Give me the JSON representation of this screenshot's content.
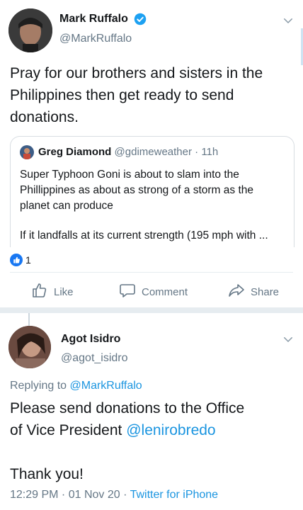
{
  "tweet": {
    "author_name": "Mark Ruffalo",
    "author_handle": "@MarkRuffalo",
    "text": "Pray for our brothers and sisters in the Philippines then get ready to send donations.",
    "quoted": {
      "author_name": "Greg Diamond",
      "author_handle": "@gdimeweather",
      "time": "· 11h",
      "text_lines": [
        "Super Typhoon Goni is about to slam into the",
        "Phillippines as about as strong of a storm as the",
        "planet can produce"
      ],
      "text_more": "If it landfalls at its current strength (195 mph with ..."
    },
    "like_count": "1",
    "actions": {
      "like": "Like",
      "comment": "Comment",
      "share": "Share"
    }
  },
  "reply": {
    "author_name": "Agot Isidro",
    "author_handle": "@agot_isidro",
    "replying_to_label": "Replying to",
    "replying_to_handle": "@MarkRuffalo",
    "text_line1": "Please send donations to the Office",
    "text_line2_prefix": "of Vice President",
    "text_line2_mention": "@lenirobredo",
    "text_thanks": "Thank you!",
    "timestamp": "12:29 PM · 01 Nov 20 ·",
    "source": "Twitter for iPhone"
  },
  "colors": {
    "accent": "#1b95e0",
    "muted": "#657786",
    "like_badge": "#1877f2"
  }
}
